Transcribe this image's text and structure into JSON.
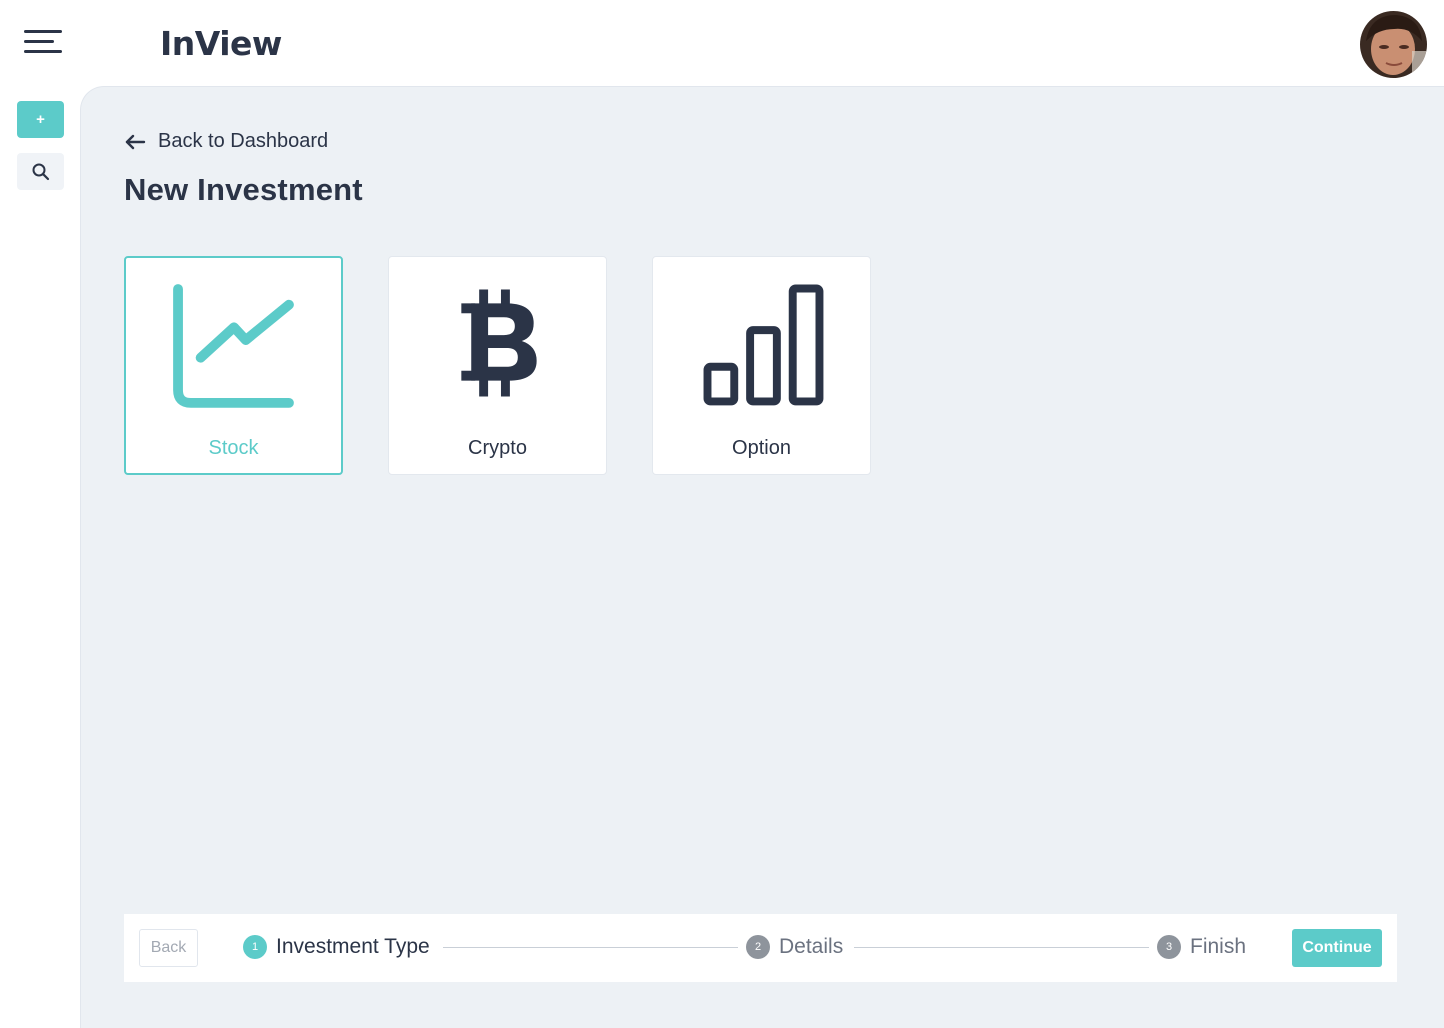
{
  "app": {
    "name": "InView"
  },
  "header": {
    "menu_icon": "hamburger-menu-icon",
    "avatar_icon": "user-avatar"
  },
  "sidebar": {
    "add_button": {
      "label": "+"
    },
    "search_button": {
      "icon": "search-icon"
    }
  },
  "main": {
    "back_link": {
      "label": "Back to Dashboard",
      "icon": "arrow-left-icon"
    },
    "title": "New Investment",
    "types": [
      {
        "label": "Stock",
        "icon": "line-chart-icon",
        "selected": true
      },
      {
        "label": "Crypto",
        "icon": "bitcoin-icon",
        "selected": false
      },
      {
        "label": "Option",
        "icon": "bar-chart-icon",
        "selected": false
      }
    ]
  },
  "stepper": {
    "back_label": "Back",
    "continue_label": "Continue",
    "steps": [
      {
        "number": "1",
        "label": "Investment Type",
        "active": true
      },
      {
        "number": "2",
        "label": "Details",
        "active": false
      },
      {
        "number": "3",
        "label": "Finish",
        "active": false
      }
    ]
  },
  "colors": {
    "accent": "#5ccbc9",
    "text": "#2b3447",
    "background": "#edf1f5"
  }
}
